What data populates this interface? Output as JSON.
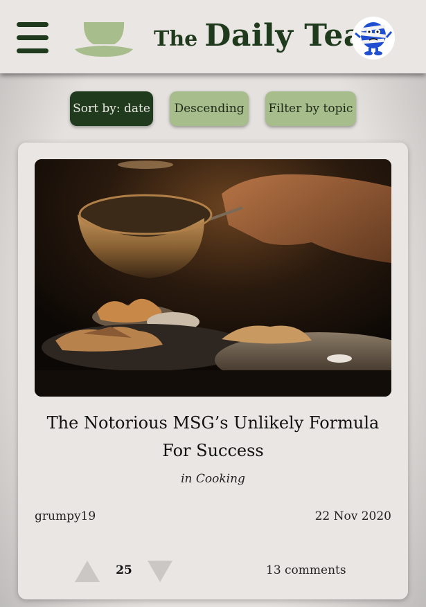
{
  "header": {
    "brand_the": "The",
    "brand_name": "Daily Tea",
    "colors": {
      "brand": "#1f3a1c",
      "accent": "#a7bd8c",
      "header_bg": "#eae6e3"
    },
    "icons": {
      "menu": "hamburger-icon",
      "logo": "teacup-logo",
      "avatar": "user-avatar"
    }
  },
  "toolbar": {
    "sort_label": "Sort by: date",
    "order_label": "Descending",
    "filter_label": "Filter by topic"
  },
  "post": {
    "title": "The Notorious MSG’s Unlikely Formula For Success",
    "topic_prefix": "in",
    "topic": "Cooking",
    "author": "grumpy19",
    "date": "22 Nov 2020",
    "votes": "25",
    "comments": "13 comments",
    "icons": {
      "upvote": "upvote-arrow-icon",
      "downvote": "downvote-arrow-icon"
    }
  }
}
